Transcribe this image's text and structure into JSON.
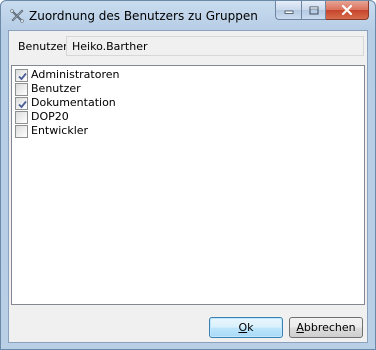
{
  "window": {
    "title": "Zuordnung des Benutzers zu Gruppen",
    "caption_buttons": {
      "minimize": "minimize-icon",
      "maximize": "maximize-icon",
      "close": "close-icon"
    }
  },
  "user": {
    "label": "Benutzer",
    "value": "Heiko.Barther"
  },
  "groups": [
    {
      "label": "Administratoren",
      "checked": true
    },
    {
      "label": "Benutzer",
      "checked": false
    },
    {
      "label": "Dokumentation",
      "checked": true
    },
    {
      "label": "DOP20",
      "checked": false
    },
    {
      "label": "Entwickler",
      "checked": false
    }
  ],
  "buttons": {
    "ok_label": "Ok",
    "ok_mnemonic": "O",
    "ok_rest": "k",
    "cancel_label": "Abbrechen",
    "cancel_mnemonic": "A",
    "cancel_rest": "bbrechen"
  },
  "colors": {
    "titlebar": "#b6cde6",
    "client": "#f0f0f0",
    "close_button": "#c6452c",
    "checkmark": "#4a5f97"
  }
}
